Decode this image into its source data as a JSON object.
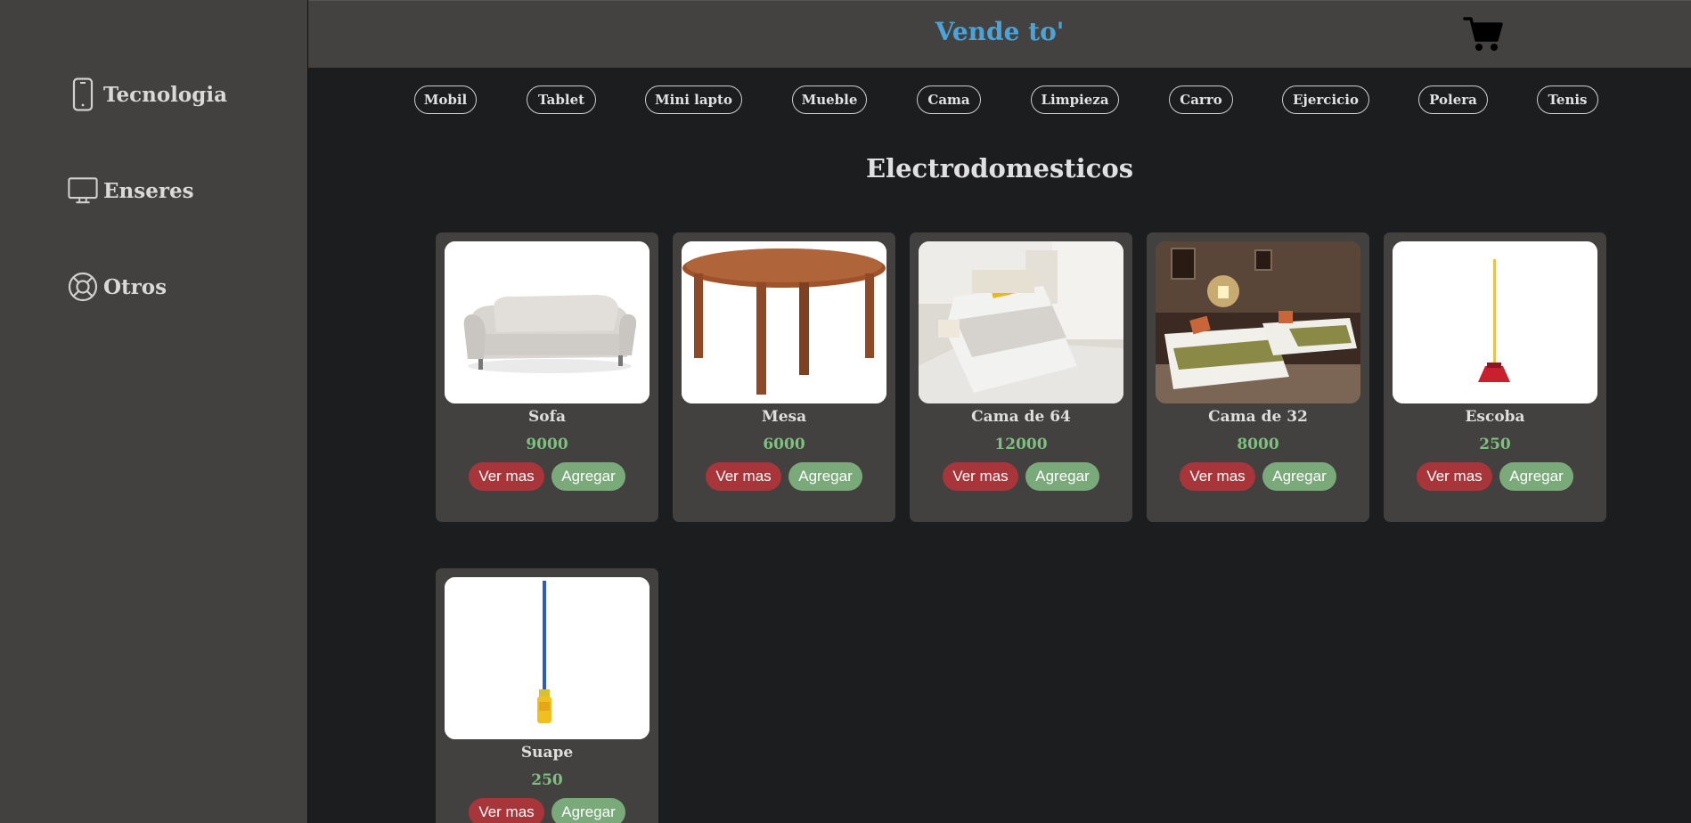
{
  "sidebar": {
    "items": [
      {
        "label": "Tecnologia",
        "icon": "smartphone-icon"
      },
      {
        "label": "Enseres",
        "icon": "monitor-icon"
      },
      {
        "label": "Otros",
        "icon": "lifebuoy-icon"
      }
    ]
  },
  "header": {
    "brand": "Vende to'",
    "cart_icon": "shopping-cart-icon"
  },
  "categories": [
    "Mobil",
    "Tablet",
    "Mini lapto",
    "Mueble",
    "Cama",
    "Limpieza",
    "Carro",
    "Ejercicio",
    "Polera",
    "Tenis"
  ],
  "section_title": "Electrodomesticos",
  "products": [
    {
      "name": "Sofa",
      "price": "9000",
      "more_label": "Ver mas",
      "add_label": "Agregar"
    },
    {
      "name": "Mesa",
      "price": "6000",
      "more_label": "Ver mas",
      "add_label": "Agregar"
    },
    {
      "name": "Cama de 64",
      "price": "12000",
      "more_label": "Ver mas",
      "add_label": "Agregar"
    },
    {
      "name": "Cama de 32",
      "price": "8000",
      "more_label": "Ver mas",
      "add_label": "Agregar"
    },
    {
      "name": "Escoba",
      "price": "250",
      "more_label": "Ver mas",
      "add_label": "Agregar"
    },
    {
      "name": "Suape",
      "price": "250",
      "more_label": "Ver mas",
      "add_label": "Agregar"
    }
  ],
  "colors": {
    "brand": "#4aa4d9",
    "price": "#7fbf7f",
    "ver_mas": "#a8353a",
    "agregar": "#7aa97a"
  }
}
